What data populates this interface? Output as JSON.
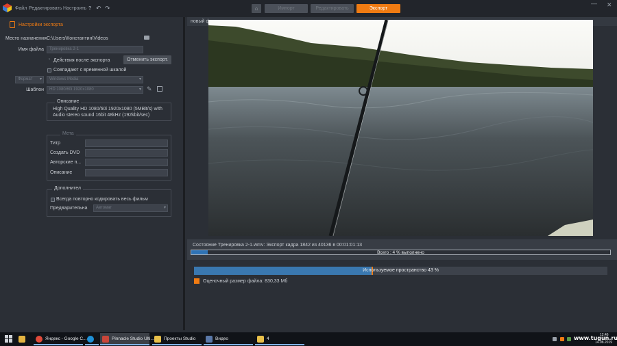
{
  "topbar": {
    "menu": [
      "Файл",
      "Редактировать",
      "Настроить"
    ],
    "help_icon": "?",
    "tabs": {
      "import": "Импорт",
      "edit": "Редактировать",
      "export": "Экспорт"
    },
    "window_controls": [
      "—",
      "✕"
    ]
  },
  "left": {
    "section_title": "Настройки экспорта",
    "destination_label": "Место назначения",
    "destination_value": "C:\\Users\\Константин\\Videos",
    "filename_label": "Имя файла",
    "filename_value": "Тренировка 2-1",
    "after_export_label": "Действия после экспорта",
    "cancel_button": "Отменить экспорт.",
    "match_timeline_label": "Совпадают с временной шкалой",
    "format_value": "Формат",
    "format_type_value": "Windows Media",
    "template_label": "Шаблон",
    "template_value": "HD 1080/60i 1920x1080",
    "description_group": "Описание",
    "description_text": "High Quality HD 1080/60i 1920x1080 (5MBit/s) with Audio stereo sound 16bit 48kHz (192kbit/sec)",
    "meta_group": "Мета",
    "meta_fields": [
      "Титр",
      "Создать DVD",
      "Авторские п...",
      "Описание"
    ],
    "extra_group": "Дополнител",
    "reencode_label": "Всегда повторно кодировать весь фильм",
    "preview_label": "Предварительна",
    "preview_value": "Автомат"
  },
  "right": {
    "preview_label": "новый ф",
    "status_text": "Состояние Тренировка 2-1.wmv: Экспорт кадра 1842 из 40136 в 00:01:01:13",
    "progress_text": "Всего : 4 % выполнено",
    "progress_pct": 4,
    "space_text": "Используемое пространство 43 %",
    "space_pct": 43,
    "estimated_size": "Оценочный размер файла: 830,33 Мб"
  },
  "taskbar": {
    "items": [
      {
        "label": "",
        "icon": "file-explorer-icon"
      },
      {
        "label": "Яндекс - Google C...",
        "icon": "chrome-icon"
      },
      {
        "label": "",
        "icon": "skype-icon"
      },
      {
        "label": "Pinnacle Studio Ulti...",
        "icon": "pinnacle-icon"
      },
      {
        "label": "Проекты Studio",
        "icon": "folder-icon"
      },
      {
        "label": "Видео",
        "icon": "video-app-icon"
      },
      {
        "label": "4",
        "icon": "folder-icon"
      }
    ],
    "watermark": "www.tugun.ru",
    "clock_time": "12:46",
    "clock_date": "14.08.2019"
  },
  "colors": {
    "accent": "#f07b12",
    "progress": "#2f73b5",
    "background": "#2b2f36"
  }
}
